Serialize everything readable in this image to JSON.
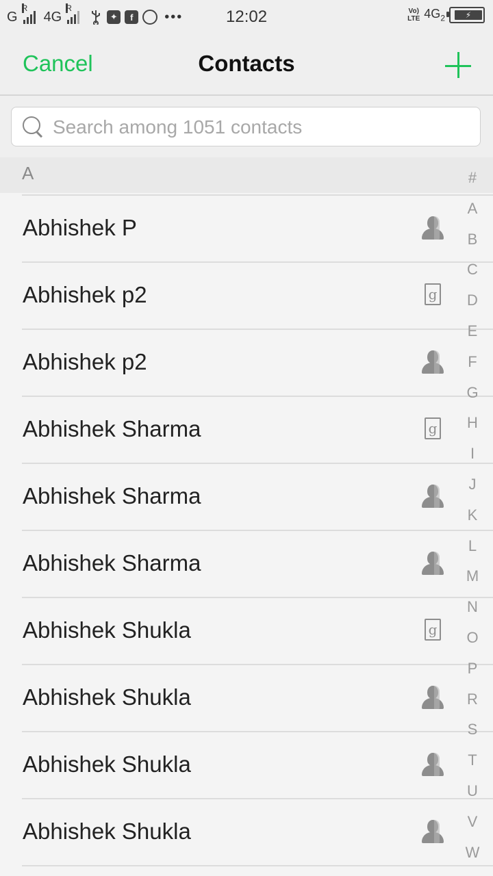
{
  "status_bar": {
    "left_network_1": "G",
    "left_roaming_1": "R",
    "left_network_2": "4G",
    "left_roaming_2": "R",
    "time": "12:02",
    "volte_top": "Vo)",
    "volte_bottom": "LTE",
    "right_network": "4G",
    "right_sim": "2",
    "more": "•••",
    "icons": [
      "usb-icon",
      "app-icon",
      "facebook-icon",
      "whatsapp-icon",
      "battery-charging-icon"
    ]
  },
  "nav": {
    "cancel_label": "Cancel",
    "title": "Contacts",
    "add_icon": "plus-icon",
    "accent_color": "#1fc35a"
  },
  "search": {
    "placeholder": "Search among 1051 contacts",
    "value": ""
  },
  "section": {
    "letter": "A"
  },
  "contacts": [
    {
      "name": "Abhishek P",
      "account": "person-icon"
    },
    {
      "name": "Abhishek p2",
      "account": "google-icon"
    },
    {
      "name": "Abhishek p2",
      "account": "person-icon"
    },
    {
      "name": "Abhishek Sharma",
      "account": "google-icon"
    },
    {
      "name": "Abhishek Sharma",
      "account": "person-icon"
    },
    {
      "name": "Abhishek Sharma",
      "account": "person-icon"
    },
    {
      "name": "Abhishek Shukla",
      "account": "google-icon"
    },
    {
      "name": "Abhishek Shukla",
      "account": "person-icon"
    },
    {
      "name": "Abhishek Shukla",
      "account": "person-icon"
    },
    {
      "name": "Abhishek Shukla",
      "account": "person-icon"
    }
  ],
  "google_glyph": "g",
  "index": [
    "#",
    "A",
    "B",
    "C",
    "D",
    "E",
    "F",
    "G",
    "H",
    "I",
    "J",
    "K",
    "L",
    "M",
    "N",
    "O",
    "P",
    "R",
    "S",
    "T",
    "U",
    "V",
    "W"
  ]
}
